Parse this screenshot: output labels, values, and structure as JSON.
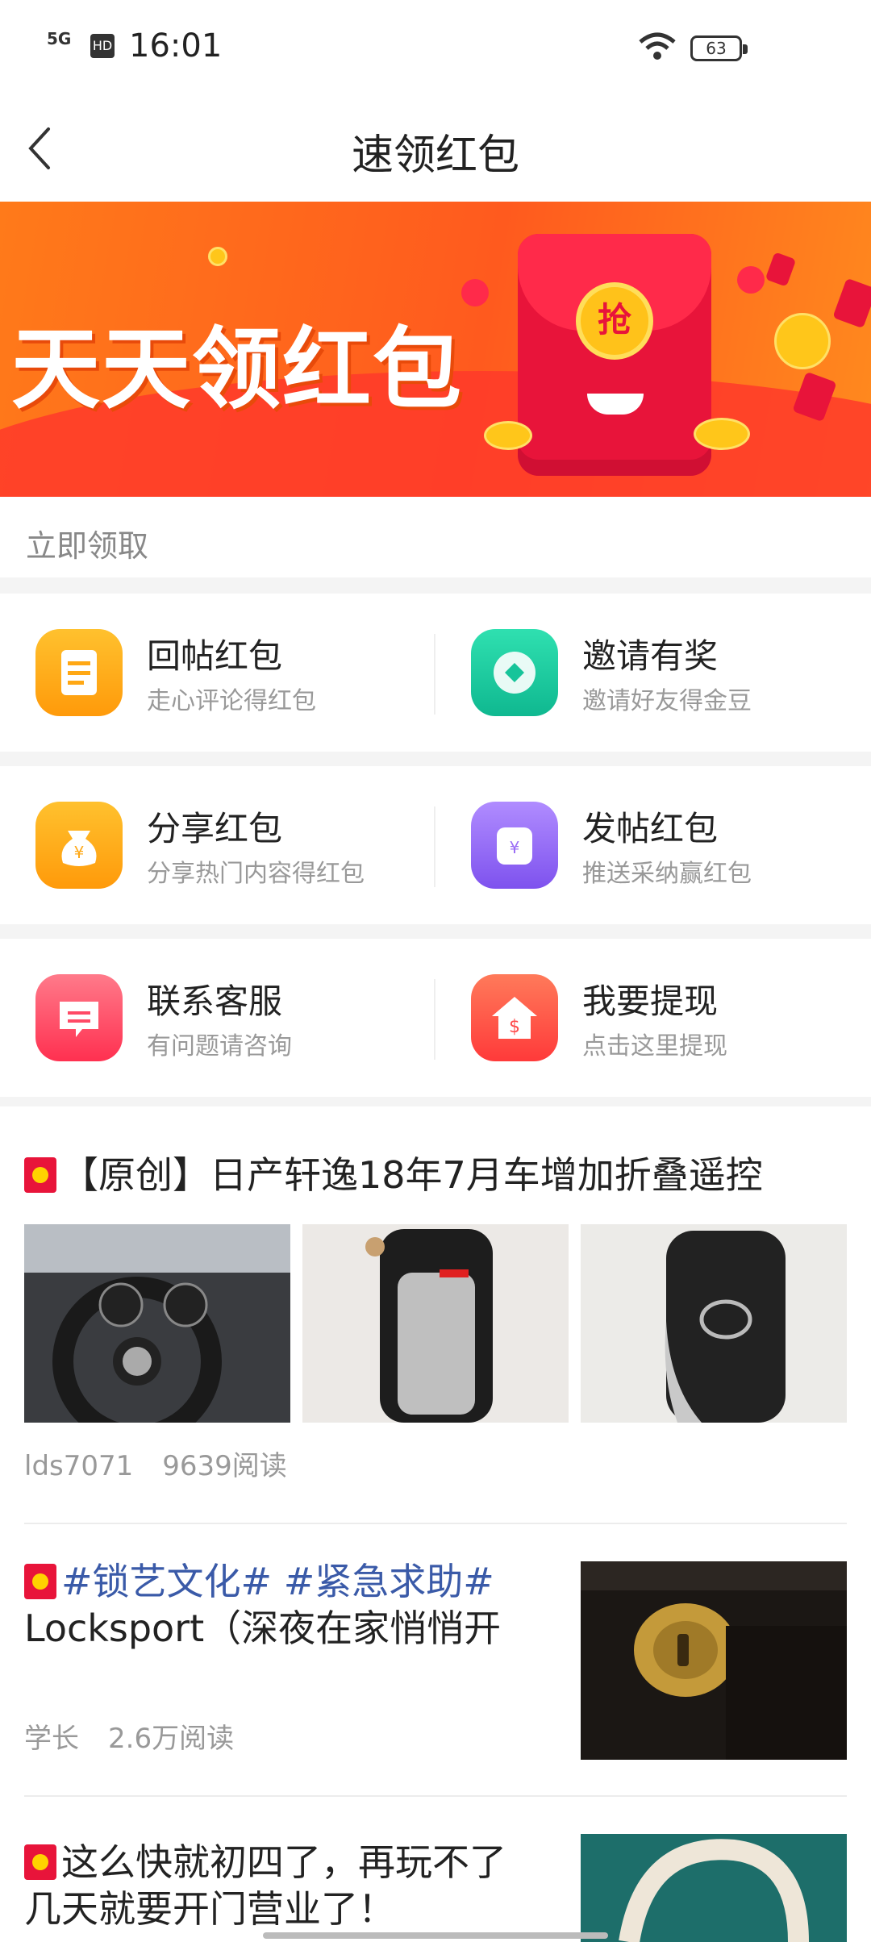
{
  "status_bar": {
    "time": "16:01",
    "signal": "5G",
    "hd": "HD",
    "battery": "63"
  },
  "header": {
    "title": "速领红包"
  },
  "banner": {
    "text": "天天领红包",
    "coin_text": "抢"
  },
  "section": {
    "label": "立即领取"
  },
  "grid": [
    [
      {
        "label": "回帖红包",
        "sub": "走心评论得红包",
        "icon": "receipt-icon",
        "color": "#ffa815"
      },
      {
        "label": "邀请有奖",
        "sub": "邀请好友得金豆",
        "icon": "invite-icon",
        "color": "#16c49a"
      }
    ],
    [
      {
        "label": "分享红包",
        "sub": "分享热门内容得红包",
        "icon": "money-bag-icon",
        "color": "#ffa815"
      },
      {
        "label": "发帖红包",
        "sub": "推送采纳赢红包",
        "icon": "yuan-jar-icon",
        "color": "#9a6cf5"
      }
    ],
    [
      {
        "label": "联系客服",
        "sub": "有问题请咨询",
        "icon": "chat-icon",
        "color": "#ff4a66"
      },
      {
        "label": "我要提现",
        "sub": "点击这里提现",
        "icon": "withdraw-house-icon",
        "color": "#ff4a4a"
      }
    ]
  ],
  "posts": [
    {
      "title": "【原创】日产轩逸18年7月车增加折叠遥控",
      "author": "lds7071",
      "reads": "9639阅读"
    },
    {
      "tags": "#锁艺文化# #紧急求助#",
      "title": "Locksport（深夜在家悄悄开",
      "author": "学长",
      "reads": "2.6万阅读"
    },
    {
      "title_line1": "这么快就初四了，再玩不了",
      "title_line2": "几天就要开门营业了！"
    }
  ]
}
